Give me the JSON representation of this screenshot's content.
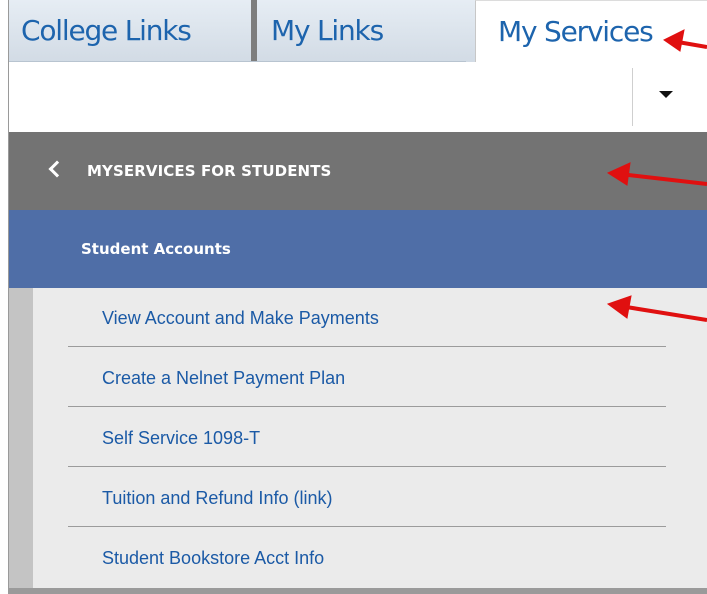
{
  "tabs": {
    "college_links": "College Links",
    "my_links": "My Links",
    "my_services": "My Services"
  },
  "section": {
    "title": "MYSERVICES FOR STUDENTS"
  },
  "category": {
    "label": "Student Accounts"
  },
  "links": [
    "View Account and Make Payments",
    "Create a Nelnet Payment Plan",
    "Self Service 1098-T",
    "Tuition and Refund Info (link)",
    "Student Bookstore Acct Info"
  ],
  "colors": {
    "tab_text": "#1d64ad",
    "header_gray": "#737373",
    "category_blue": "#4f6ea7",
    "link_blue": "#1b5aa6",
    "annotation_red": "#e01010"
  },
  "icons": {
    "back": "chevron-left-icon",
    "dropdown": "caret-down-icon",
    "annotation": "red-arrow-icon"
  }
}
